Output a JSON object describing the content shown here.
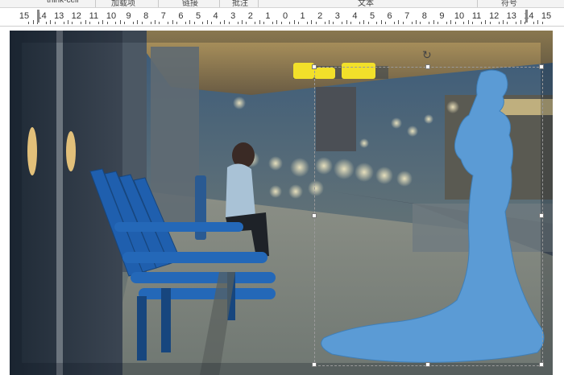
{
  "ribbon": {
    "groups": [
      "think-cell",
      "加载项",
      "链接",
      "批注",
      "文本",
      "符号"
    ]
  },
  "ruler": {
    "labels": [
      "15",
      "14",
      "13",
      "12",
      "11",
      "10",
      "9",
      "8",
      "7",
      "6",
      "5",
      "4",
      "3",
      "2",
      "1",
      "0",
      "1",
      "2",
      "3",
      "4",
      "5",
      "6",
      "7",
      "8",
      "9",
      "10",
      "11",
      "12",
      "13",
      "14",
      "15"
    ]
  },
  "slide": {
    "photo_description_icon": "railway-platform-photo",
    "shape_fill_color": "#5b9bd5",
    "highlight_color": "#f2e02a",
    "rotate_icon": "rotate-icon"
  }
}
